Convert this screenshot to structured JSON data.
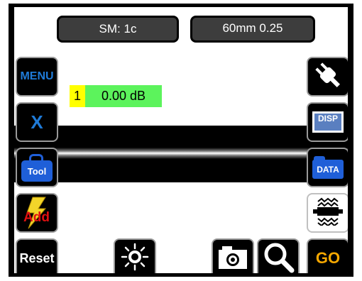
{
  "header": {
    "fiber_mode": "SM: 1c",
    "cleave_setting": "60mm 0.25"
  },
  "left_buttons": {
    "menu": "MENU",
    "cancel": "X",
    "tool": "Tool",
    "add": "Add",
    "reset": "Reset"
  },
  "right_buttons": {
    "disp": "DISP",
    "data": "DATA",
    "go": "GO"
  },
  "splice_loss": {
    "index": "1",
    "value": "0.00 dB"
  },
  "icons": {
    "power": "power-plug-icon",
    "brightness": "sun-icon",
    "camera": "camera-icon",
    "zoom": "magnifier-icon",
    "heater": "heater-icon"
  },
  "colors": {
    "header_pill": "#3d3d3d",
    "loss_index_bg": "#ffff00",
    "loss_value_bg": "#5cf35c",
    "menu_text": "#1f7bd8",
    "cancel_text": "#1f7bd8",
    "tool_blue": "#1f5fd8",
    "add_red": "#e01010",
    "go_orange": "#f7a800"
  }
}
